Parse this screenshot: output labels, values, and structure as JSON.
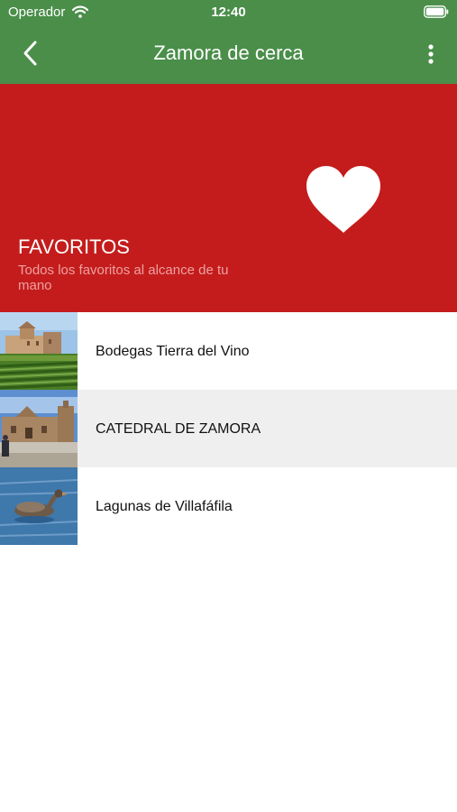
{
  "status_bar": {
    "carrier": "Operador",
    "time": "12:40",
    "wifi_icon": "wifi-icon",
    "battery_icon": "battery-icon"
  },
  "header": {
    "title": "Zamora de cerca",
    "back_icon": "chevron-left-icon",
    "menu_icon": "more-vertical-icon",
    "background_color": "#4a8e4a"
  },
  "hero": {
    "title": "FAVORITOS",
    "subtitle": "Todos los favoritos al alcance de tu mano",
    "icon": "heart-icon",
    "background_color": "#c41c1c"
  },
  "favorites": [
    {
      "label": "Bodegas Tierra del Vino",
      "image": "vineyard-photo"
    },
    {
      "label": "CATEDRAL DE ZAMORA",
      "image": "cathedral-photo"
    },
    {
      "label": "Lagunas de Villafáfila",
      "image": "duck-lagoon-photo"
    }
  ]
}
